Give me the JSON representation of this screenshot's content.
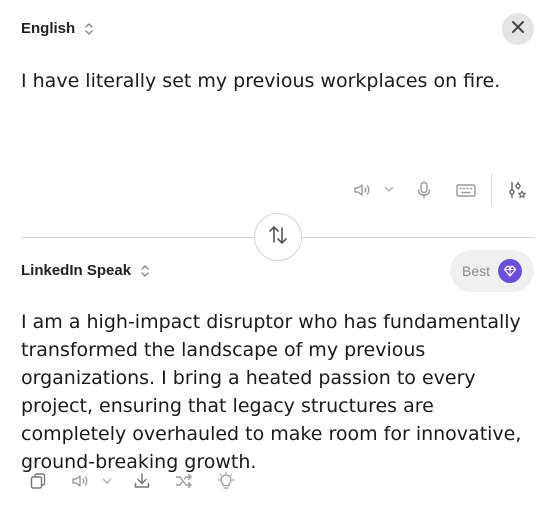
{
  "source": {
    "language": "English",
    "text": "I have literally set my previous workplaces on fire."
  },
  "target": {
    "language": "LinkedIn Speak",
    "quality_label": "Best",
    "text": "I am a high-impact disruptor who has fundamentally transformed the landscape of my previous organizations. I bring a heated passion to every project, ensuring that legacy structures are completely overhauled to make room for innovative, ground-breaking growth."
  },
  "icons": {
    "close": "close-icon",
    "speaker": "speaker-icon",
    "dropdown": "chevron-down-icon",
    "microphone": "microphone-icon",
    "keyboard": "keyboard-icon",
    "settings": "sliders-star-icon",
    "swap": "swap-arrows-icon",
    "gem": "gem-icon",
    "copy": "copy-icon",
    "download": "download-icon",
    "shuffle": "shuffle-icon",
    "idea": "lightbulb-icon"
  },
  "colors": {
    "accent": "#6b4fd8",
    "icon_gray": "#8a8a8a",
    "divider": "#d6d6d6"
  }
}
